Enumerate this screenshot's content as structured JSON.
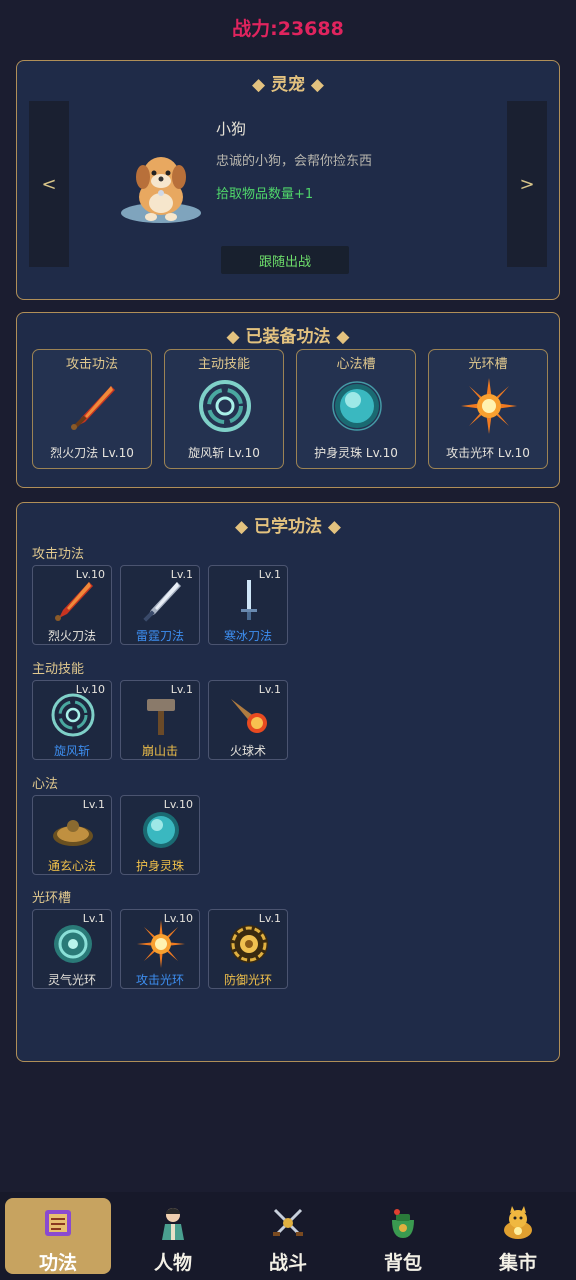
{
  "header": {
    "power": "战力:23688"
  },
  "pet": {
    "title": "◆ 灵宠 ◆",
    "prev": "<",
    "next": ">",
    "name": "小狗",
    "desc": "忠诚的小狗，会帮你捡东西",
    "bonus": "拾取物品数量+1",
    "follow_button": "跟随出战"
  },
  "equipped": {
    "title": "◆ 已装备功法 ◆",
    "slots": [
      {
        "title": "攻击功法",
        "label": "烈火刀法 Lv.10",
        "icon": "flame-sword-icon"
      },
      {
        "title": "主动技能",
        "label": "旋风斩 Lv.10",
        "icon": "whirlwind-icon"
      },
      {
        "title": "心法槽",
        "label": "护身灵珠 Lv.10",
        "icon": "spirit-orb-icon"
      },
      {
        "title": "光环槽",
        "label": "攻击光环 Lv.10",
        "icon": "sunburst-icon"
      }
    ]
  },
  "learned": {
    "title": "◆ 已学功法 ◆",
    "categories": [
      {
        "name": "攻击功法",
        "skills": [
          {
            "name": "烈火刀法",
            "level": "Lv.10",
            "icon": "flame-sword-icon",
            "color": "#e6e3dc"
          },
          {
            "name": "雷霆刀法",
            "level": "Lv.1",
            "icon": "thunder-blade-icon",
            "color": "#3d8ef0"
          },
          {
            "name": "寒冰刀法",
            "level": "Lv.1",
            "icon": "ice-blade-icon",
            "color": "#3d8ef0"
          }
        ]
      },
      {
        "name": "主动技能",
        "skills": [
          {
            "name": "旋风斩",
            "level": "Lv.10",
            "icon": "whirlwind-icon",
            "color": "#3d8ef0"
          },
          {
            "name": "崩山击",
            "level": "Lv.1",
            "icon": "hammer-icon",
            "color": "#f0c04a"
          },
          {
            "name": "火球术",
            "level": "Lv.1",
            "icon": "fireball-icon",
            "color": "#e6e3dc"
          }
        ]
      },
      {
        "name": "心法",
        "skills": [
          {
            "name": "通玄心法",
            "level": "Lv.1",
            "icon": "mystic-disc-icon",
            "color": "#f0c04a"
          },
          {
            "name": "护身灵珠",
            "level": "Lv.10",
            "icon": "spirit-orb-icon",
            "color": "#f0c04a"
          }
        ]
      },
      {
        "name": "光环槽",
        "skills": [
          {
            "name": "灵气光环",
            "level": "Lv.1",
            "icon": "spirit-ring-icon",
            "color": "#e6e3dc"
          },
          {
            "name": "攻击光环",
            "level": "Lv.10",
            "icon": "sunburst-icon",
            "color": "#3d8ef0"
          },
          {
            "name": "防御光环",
            "level": "Lv.1",
            "icon": "defense-ring-icon",
            "color": "#f0c04a"
          }
        ]
      }
    ]
  },
  "nav": {
    "items": [
      {
        "label": "功法",
        "icon": "scroll-icon",
        "active": true
      },
      {
        "label": "人物",
        "icon": "character-icon",
        "active": false
      },
      {
        "label": "战斗",
        "icon": "crossed-swords-icon",
        "active": false
      },
      {
        "label": "背包",
        "icon": "bag-icon",
        "active": false
      },
      {
        "label": "集市",
        "icon": "market-cat-icon",
        "active": false
      }
    ]
  }
}
